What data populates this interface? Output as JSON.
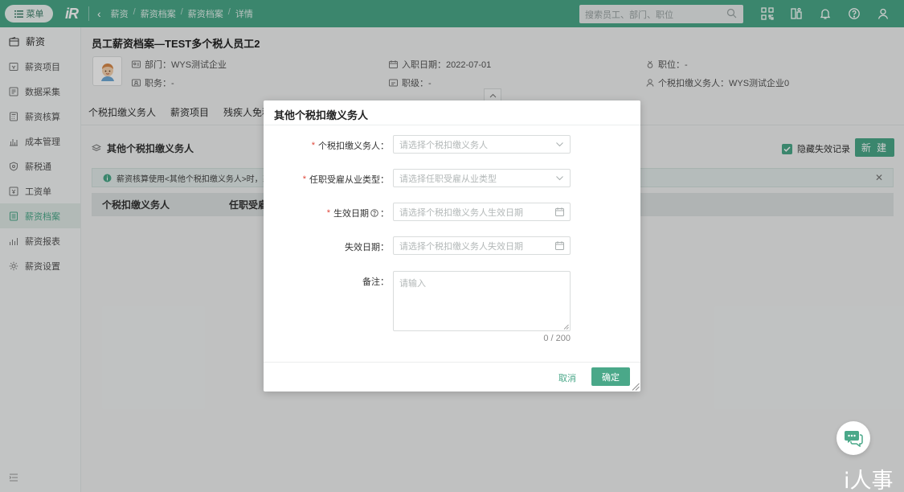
{
  "topbar": {
    "menu_label": "菜单",
    "logo_text": "iR",
    "breadcrumbs": [
      "薪资",
      "薪资档案",
      "薪资档案",
      "详情"
    ],
    "search_placeholder": "搜索员工、部门、职位"
  },
  "sidebar": {
    "header": "薪资",
    "items": [
      {
        "label": "薪资项目",
        "icon": "salary-item-icon"
      },
      {
        "label": "数据采集",
        "icon": "data-collect-icon"
      },
      {
        "label": "薪资核算",
        "icon": "calculator-icon"
      },
      {
        "label": "成本管理",
        "icon": "cost-icon"
      },
      {
        "label": "薪税通",
        "icon": "shield-icon"
      },
      {
        "label": "工资单",
        "icon": "payslip-icon"
      },
      {
        "label": "薪资档案",
        "icon": "archive-icon",
        "active": true
      },
      {
        "label": "薪资报表",
        "icon": "report-icon"
      },
      {
        "label": "薪资设置",
        "icon": "gear-icon"
      }
    ]
  },
  "employee": {
    "title": "员工薪资档案—TEST多个税人员工2",
    "department": "部门：WYS测试企业",
    "hire_date": "入职日期：2022-07-01",
    "position": "职位：-",
    "duty": "职务：-",
    "level": "职级：-",
    "tax_agent": "个税扣缴义务人：WYS测试企业0"
  },
  "tabs": [
    "个税扣缴义务人",
    "薪资项目",
    "残疾人免税"
  ],
  "section": {
    "title": "其他个税扣缴义务人",
    "hide_invalid": "隐藏失效记录",
    "new_button": "新 建",
    "notice": "薪资核算使用<其他个税扣缴义务人>时，系统",
    "columns": [
      "个税扣缴义务人",
      "任职受雇"
    ]
  },
  "modal": {
    "title": "其他个税扣缴义务人",
    "fields": {
      "tax_agent": {
        "label": "个税扣缴义务人：",
        "placeholder": "请选择个税扣缴义务人"
      },
      "employment_type": {
        "label": "任职受雇从业类型：",
        "placeholder": "请选择任职受雇从业类型"
      },
      "effective_date": {
        "label": "生效日期",
        "label_suffix": "：",
        "placeholder": "请选择个税扣缴义务人生效日期"
      },
      "expiry_date": {
        "label": "失效日期：",
        "placeholder": "请选择个税扣缴义务人失效日期"
      },
      "remark": {
        "label": "备注：",
        "placeholder": "请输入",
        "counter": "0 / 200"
      }
    },
    "cancel_label": "取消",
    "ok_label": "确定"
  },
  "watermark": "i人事",
  "colors": {
    "brand": "#4aa889",
    "required": "#e0473a"
  }
}
